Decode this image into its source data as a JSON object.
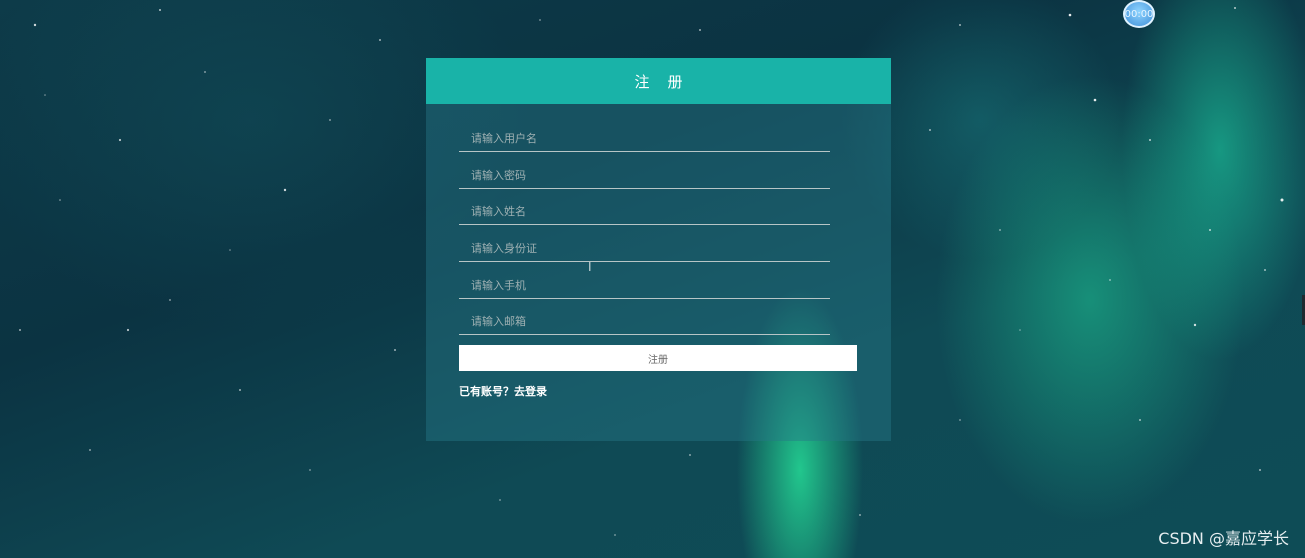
{
  "overlay": {
    "timer": "00:00",
    "watermark": "CSDN @嘉应学长"
  },
  "register_form": {
    "title": "注册",
    "fields": [
      {
        "name": "username",
        "placeholder": "请输入用户名"
      },
      {
        "name": "password",
        "placeholder": "请输入密码"
      },
      {
        "name": "real_name",
        "placeholder": "请输入姓名"
      },
      {
        "name": "id_card",
        "placeholder": "请输入身份证"
      },
      {
        "name": "phone",
        "placeholder": "请输入手机"
      },
      {
        "name": "email",
        "placeholder": "请输入邮箱"
      }
    ],
    "submit_label": "注册",
    "login_link": "已有账号？去登录"
  },
  "colors": {
    "header": "#19b3a8",
    "panel": "#26788773",
    "button": "#ffffff"
  }
}
